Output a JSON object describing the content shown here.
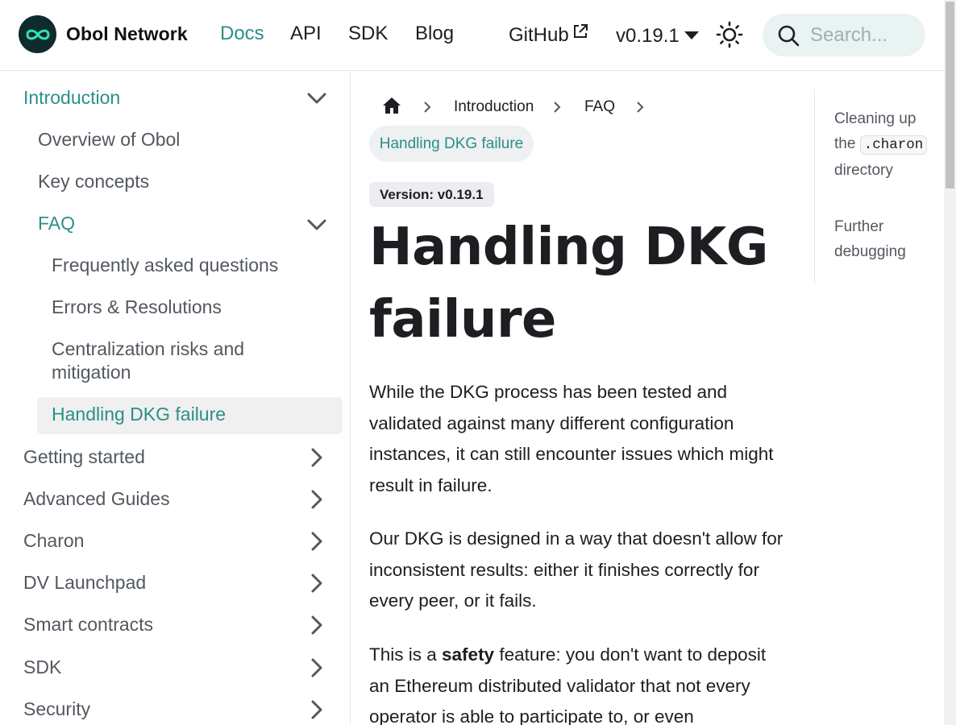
{
  "navbar": {
    "brand": "Obol Network",
    "links": [
      "Docs",
      "API",
      "SDK",
      "Blog"
    ],
    "github_label": "GitHub",
    "version_label": "v0.19.1",
    "search_placeholder": "Search..."
  },
  "sidebar": {
    "items": [
      {
        "label": "Introduction",
        "state": "expanded-active"
      },
      {
        "label": "Overview of Obol"
      },
      {
        "label": "Key concepts"
      },
      {
        "label": "FAQ",
        "state": "expanded-active"
      },
      {
        "label": "Frequently asked questions"
      },
      {
        "label": "Errors & Resolutions"
      },
      {
        "label": "Centralization risks and mitigation"
      },
      {
        "label": "Handling DKG failure",
        "state": "selected"
      },
      {
        "label": "Getting started"
      },
      {
        "label": "Advanced Guides"
      },
      {
        "label": "Charon"
      },
      {
        "label": "DV Launchpad"
      },
      {
        "label": "Smart contracts"
      },
      {
        "label": "SDK"
      },
      {
        "label": "Security"
      }
    ]
  },
  "breadcrumb": {
    "items": [
      "Introduction",
      "FAQ"
    ],
    "current": "Handling DKG failure"
  },
  "content": {
    "version_badge": "Version: v0.19.1",
    "title_line1": "Handling DKG",
    "title_line2": "failure",
    "p1": "While the DKG process has been tested and validated against many different configuration instances, it can still encounter issues which might result in failure.",
    "p2": "Our DKG is designed in a way that doesn't allow for inconsistent results: either it finishes correctly for every peer, or it fails.",
    "p3_before": "This is a ",
    "p3_bold": "safety",
    "p3_after": " feature: you don't want to deposit an Ethereum distributed validator that not every operator is able to participate to, or even"
  },
  "toc": {
    "item1_before": "Cleaning up the",
    "item1_code": ".charon",
    "item1_after": "directory",
    "item2": "Further debugging"
  },
  "colors": {
    "accent": "#2a8f88",
    "logo_bg": "#0e2b2d",
    "search_bg": "#e9f3f2",
    "selected_bg": "#f0f0f0"
  }
}
